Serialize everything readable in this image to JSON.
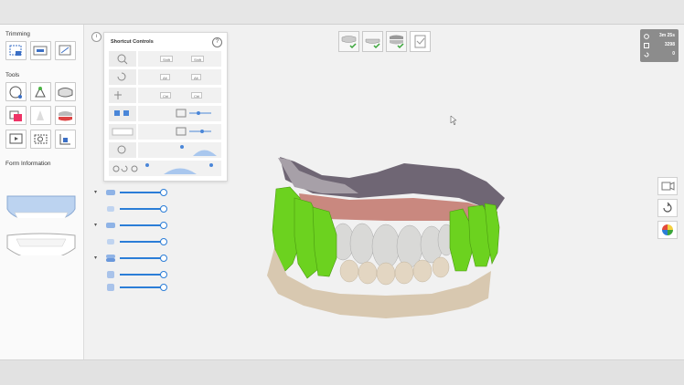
{
  "sidebar": {
    "sections": {
      "trimming": "Trimming",
      "tools": "Tools",
      "form_information": "Form Information"
    },
    "trimming_tools": [
      "trim-box-icon",
      "trim-region-icon",
      "trim-free-icon"
    ],
    "tool_buttons": [
      "sphere-icon",
      "brush-icon",
      "jaw-icon",
      "overlay-icon",
      "align-icon",
      "bite-icon",
      "play-icon",
      "camera-icon",
      "measure-icon"
    ]
  },
  "shortcut_controls": {
    "title": "Shortcut Controls",
    "help": "?",
    "keys": {
      "shift": "Shift",
      "alt": "Alt",
      "ctrl": "Ctrl"
    }
  },
  "info_button": "i",
  "stage_buttons": [
    "upper-jaw-stage",
    "lower-jaw-stage",
    "bite-stage",
    "confirm-stage"
  ],
  "scan_info": {
    "time": "3m 25s",
    "count": "3298",
    "other": "0"
  },
  "colors": {
    "accent": "#2b7dd7",
    "check_green": "#3aa53a",
    "teeth_green": "#6cd21f",
    "gingiva": "#c9887f"
  }
}
